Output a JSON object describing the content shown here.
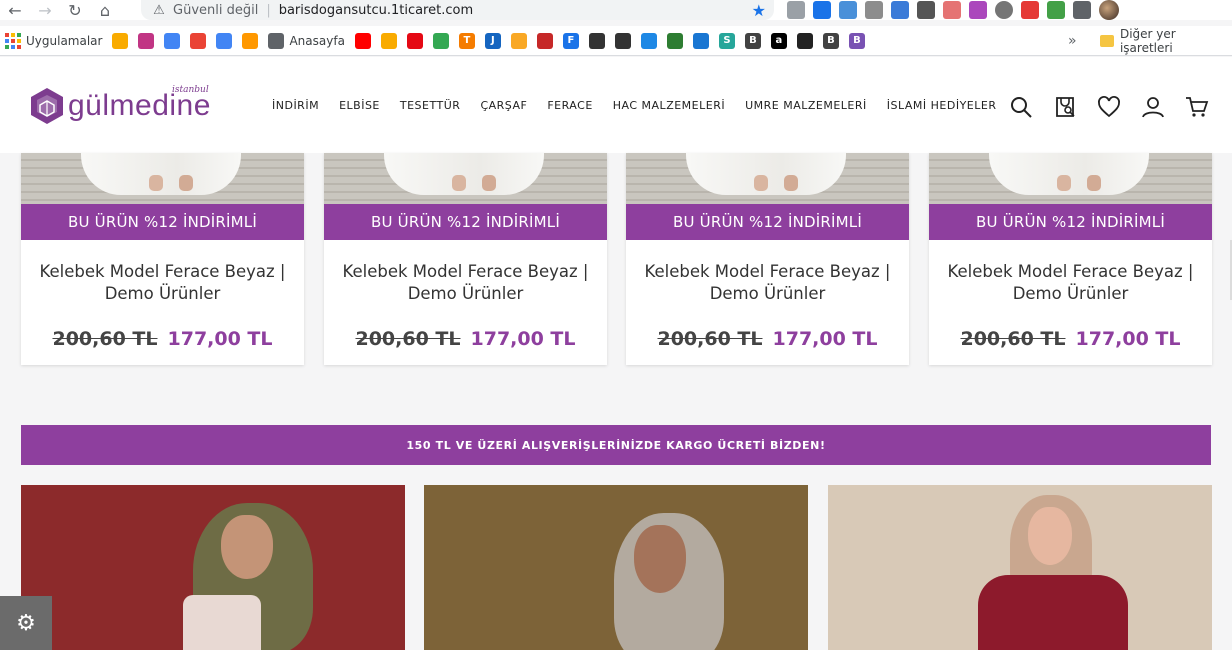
{
  "browser": {
    "security_label": "Güvenli değil",
    "url": "barisdogansutcu.1ticaret.com",
    "bookmarks": [
      {
        "label": "Uygulamalar",
        "icon": "apps-icon"
      },
      {
        "label": "",
        "icon": "bookmark-pen-icon"
      },
      {
        "label": "",
        "icon": "instagram-icon"
      },
      {
        "label": "",
        "icon": "google-icon"
      },
      {
        "label": "",
        "icon": "gmail-icon"
      },
      {
        "label": "",
        "icon": "translate-icon"
      },
      {
        "label": "",
        "icon": "cloud-icon"
      },
      {
        "label": "Anasayfa",
        "icon": "globe-icon"
      },
      {
        "label": "",
        "icon": "youtube-icon"
      },
      {
        "label": "",
        "icon": "analytics-icon"
      },
      {
        "label": "",
        "icon": "netflix-icon"
      },
      {
        "label": "",
        "icon": "ads-icon"
      },
      {
        "label": "T",
        "icon": "t-orange-icon"
      },
      {
        "label": "J",
        "icon": "j-blue-icon"
      },
      {
        "label": "",
        "icon": "paw-icon"
      },
      {
        "label": "",
        "icon": "shield-red-icon"
      },
      {
        "label": "F",
        "icon": "f-blue-icon"
      },
      {
        "label": "",
        "icon": "figure-icon"
      },
      {
        "label": "",
        "icon": "figure2-icon"
      },
      {
        "label": "",
        "icon": "ring-icon"
      },
      {
        "label": "",
        "icon": "plus-green-icon"
      },
      {
        "label": "",
        "icon": "grid-icon"
      },
      {
        "label": "S",
        "icon": "s-teal-icon"
      },
      {
        "label": "B",
        "icon": "b-icon"
      },
      {
        "label": "a",
        "icon": "amazon-icon"
      },
      {
        "label": "",
        "icon": "dp-icon"
      },
      {
        "label": "B",
        "icon": "b2-icon"
      },
      {
        "label": "B",
        "icon": "bootstrap-icon"
      }
    ],
    "more_label": "»",
    "other_bookmarks": "Diğer yer işaretleri"
  },
  "site": {
    "logo_text": "gülmedine",
    "logo_sub": "istanbul",
    "nav": [
      "İNDİRİM",
      "ELBİSE",
      "TESETTÜR",
      "ÇARŞAF",
      "FERACE",
      "HAC MALZEMELERİ",
      "UMRE MALZEMELERİ",
      "İSLAMİ HEDİYELER"
    ],
    "icons": [
      "search-icon",
      "store-search-icon",
      "heart-icon",
      "user-icon",
      "cart-icon"
    ]
  },
  "products": [
    {
      "badge": "BU ÜRÜN %12 İNDİRİMLİ",
      "title": "Kelebek Model Ferace Beyaz | Demo Ürünler",
      "old_price": "200,60 TL",
      "new_price": "177,00 TL"
    },
    {
      "badge": "BU ÜRÜN %12 İNDİRİMLİ",
      "title": "Kelebek Model Ferace Beyaz | Demo Ürünler",
      "old_price": "200,60 TL",
      "new_price": "177,00 TL"
    },
    {
      "badge": "BU ÜRÜN %12 İNDİRİMLİ",
      "title": "Kelebek Model Ferace Beyaz | Demo Ürünler",
      "old_price": "200,60 TL",
      "new_price": "177,00 TL"
    },
    {
      "badge": "BU ÜRÜN %12 İNDİRİMLİ",
      "title": "Kelebek Model Ferace Beyaz | Demo Ürünler",
      "old_price": "200,60 TL",
      "new_price": "177,00 TL"
    }
  ],
  "shipping_banner": "150 TL VE ÜZERİ ALIŞVERİŞLERİNİZDE KARGO ÜCRETİ BİZDEN!",
  "colors": {
    "brand_purple": "#8e3f9e",
    "text_dark": "#333333"
  }
}
